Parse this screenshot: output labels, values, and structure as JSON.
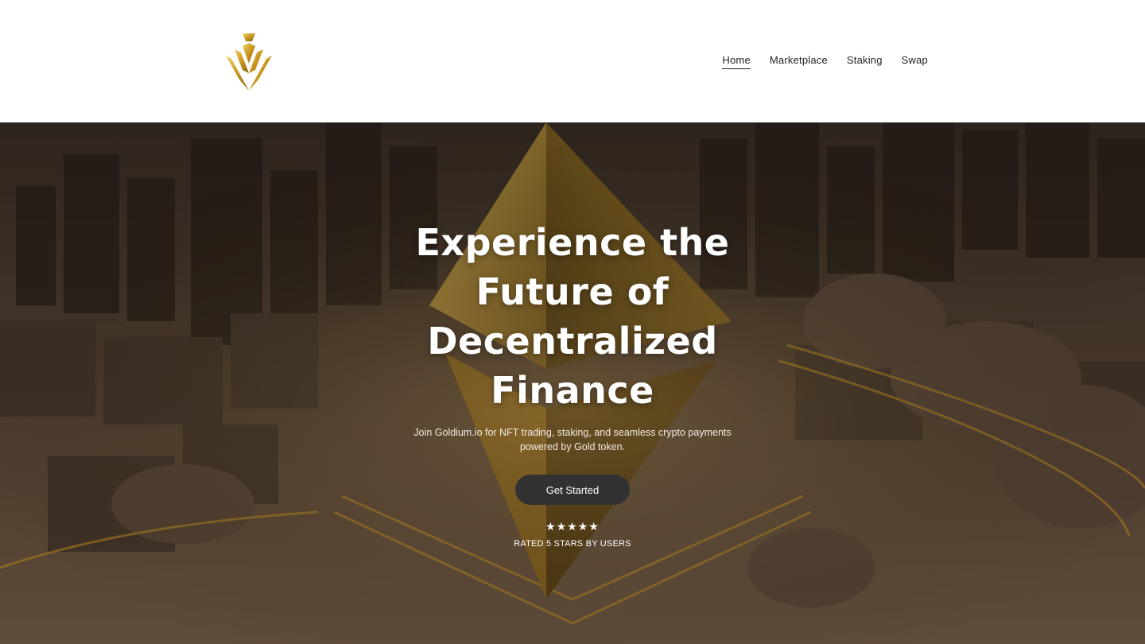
{
  "header": {
    "logo_icon": "goldium-wheat-logo",
    "nav": [
      {
        "label": "Home",
        "active": true
      },
      {
        "label": "Marketplace",
        "active": false
      },
      {
        "label": "Staking",
        "active": false
      },
      {
        "label": "Swap",
        "active": false
      }
    ]
  },
  "hero": {
    "headline": "Experience the Future of Decentralized Finance",
    "subtext": "Join Goldium.io for NFT trading, staking, and seamless crypto payments powered by Gold token.",
    "cta_label": "Get Started",
    "stars": "★★★★★",
    "rating_text": "RATED 5 STARS BY USERS",
    "background_image": "golden-ethereum-crystal-over-miniature-city"
  },
  "colors": {
    "gold": "#d4a62a",
    "cta_bg": "#323232",
    "nav_text": "#222222"
  }
}
